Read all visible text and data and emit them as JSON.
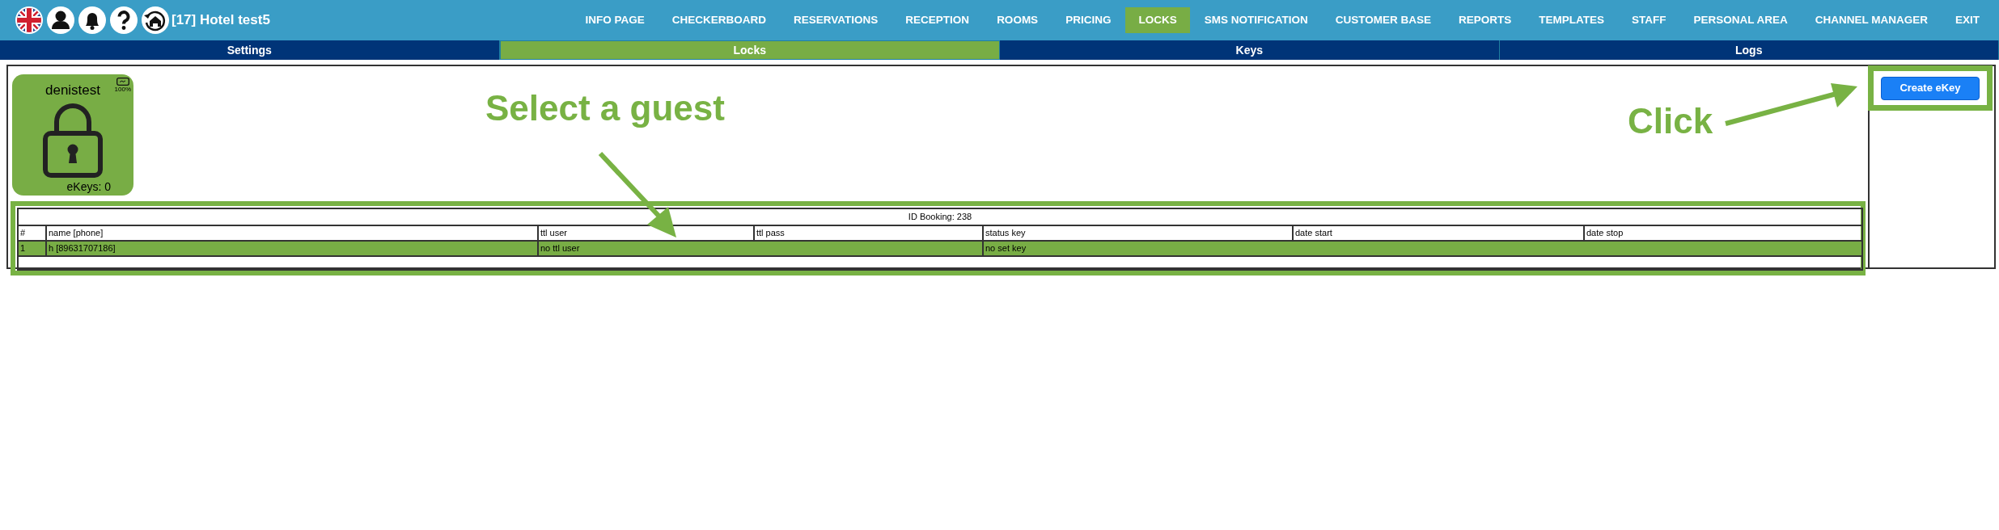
{
  "header": {
    "title": "[17] Hotel test5",
    "nav": [
      {
        "label": "INFO PAGE",
        "selected": false
      },
      {
        "label": "CHECKERBOARD",
        "selected": false
      },
      {
        "label": "RESERVATIONS",
        "selected": false
      },
      {
        "label": "RECEPTION",
        "selected": false
      },
      {
        "label": "ROOMS",
        "selected": false
      },
      {
        "label": "PRICING",
        "selected": false
      },
      {
        "label": "LOCKS",
        "selected": true
      },
      {
        "label": "SMS NOTIFICATION",
        "selected": false
      },
      {
        "label": "CUSTOMER BASE",
        "selected": false
      },
      {
        "label": "REPORTS",
        "selected": false
      },
      {
        "label": "TEMPLATES",
        "selected": false
      },
      {
        "label": "STAFF",
        "selected": false
      },
      {
        "label": "PERSONAL AREA",
        "selected": false
      },
      {
        "label": "CHANNEL MANAGER",
        "selected": false
      },
      {
        "label": "EXIT",
        "selected": false
      }
    ]
  },
  "subtabs": [
    {
      "label": "Settings",
      "selected": false
    },
    {
      "label": "Locks",
      "selected": true
    },
    {
      "label": "Keys",
      "selected": false
    },
    {
      "label": "Logs",
      "selected": false
    }
  ],
  "lock": {
    "name": "denistest",
    "battery": "100%",
    "ekeys": "eKeys: 0"
  },
  "booking_table": {
    "caption": "ID Booking: 238",
    "columns": [
      "#",
      "name [phone]",
      "ttl user",
      "ttl pass",
      "status key",
      "date start",
      "date stop"
    ],
    "rows": [
      {
        "#": "1",
        "name [phone]": "h [89631707186]",
        "ttl user": "no ttl user",
        "status key": "no set key",
        "selected": true
      }
    ]
  },
  "create_button": "Create eKey",
  "annotations": [
    {
      "kind": "label",
      "text": "Select a guest"
    },
    {
      "kind": "label",
      "text": "Click"
    }
  ]
}
